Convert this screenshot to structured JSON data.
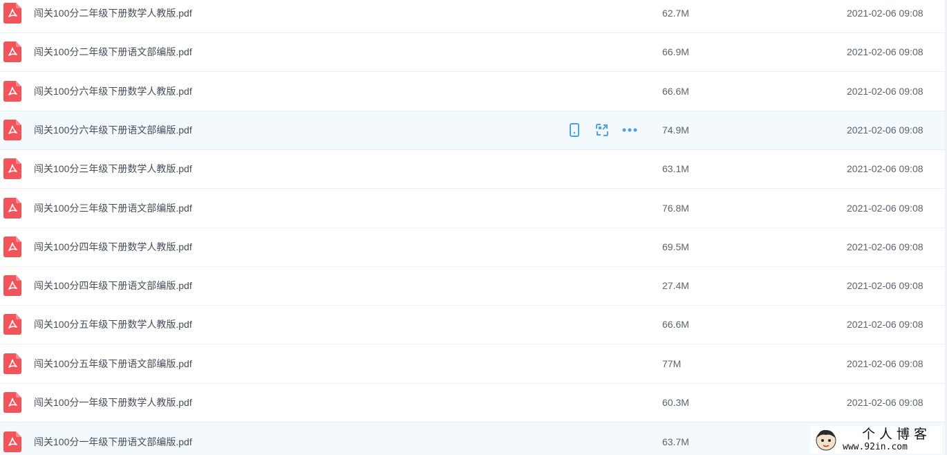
{
  "colors": {
    "pdf_red": "#f2545b",
    "action_blue": "#4aa3e6",
    "hover_bg": "#f4f9fd"
  },
  "files": [
    {
      "name": "闯关100分二年级下册数学人教版.pdf",
      "size": "62.7M",
      "modified": "2021-02-06 09:08"
    },
    {
      "name": "闯关100分二年级下册语文部编版.pdf",
      "size": "66.9M",
      "modified": "2021-02-06 09:08"
    },
    {
      "name": "闯关100分六年级下册数学人教版.pdf",
      "size": "66.6M",
      "modified": "2021-02-06 09:08"
    },
    {
      "name": "闯关100分六年级下册语文部编版.pdf",
      "size": "74.9M",
      "modified": "2021-02-06 09:08"
    },
    {
      "name": "闯关100分三年级下册数学人教版.pdf",
      "size": "63.1M",
      "modified": "2021-02-06 09:08"
    },
    {
      "name": "闯关100分三年级下册语文部编版.pdf",
      "size": "76.8M",
      "modified": "2021-02-06 09:08"
    },
    {
      "name": "闯关100分四年级下册数学人教版.pdf",
      "size": "69.5M",
      "modified": "2021-02-06 09:08"
    },
    {
      "name": "闯关100分四年级下册语文部编版.pdf",
      "size": "27.4M",
      "modified": "2021-02-06 09:08"
    },
    {
      "name": "闯关100分五年级下册数学人教版.pdf",
      "size": "66.6M",
      "modified": "2021-02-06 09:08"
    },
    {
      "name": "闯关100分五年级下册语文部编版.pdf",
      "size": "77M",
      "modified": "2021-02-06 09:08"
    },
    {
      "name": "闯关100分一年级下册数学人教版.pdf",
      "size": "60.3M",
      "modified": "2021-02-06 09:08"
    },
    {
      "name": "闯关100分一年级下册语文部编版.pdf",
      "size": "63.7M",
      "modified": ""
    }
  ],
  "hovered_row_index": 3,
  "hover_actions": [
    {
      "icon": "phone-icon",
      "label": ""
    },
    {
      "icon": "share-icon",
      "label": ""
    },
    {
      "icon": "more-icon",
      "label": ""
    }
  ],
  "watermark": {
    "title": "个人博客",
    "url": "www.92in.com"
  }
}
